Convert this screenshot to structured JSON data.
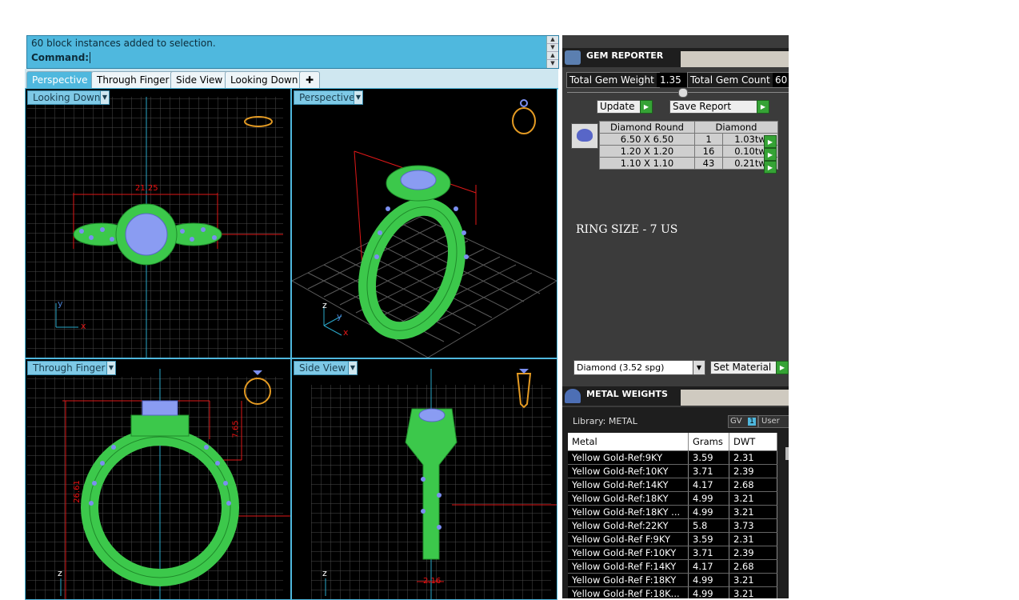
{
  "command": {
    "message": "60 block instances added to selection.",
    "prompt": "Command:"
  },
  "view_tabs": [
    {
      "label": "Perspective",
      "active": true
    },
    {
      "label": "Through Finger",
      "active": false
    },
    {
      "label": "Side View",
      "active": false
    },
    {
      "label": "Looking Down",
      "active": false
    }
  ],
  "add_tab_icon": "plus-icon",
  "viewports": {
    "looking_down": {
      "label": "Looking Down",
      "dimension": "21.25",
      "axis_y": "y",
      "axis_x": "x"
    },
    "perspective": {
      "label": "Perspective",
      "axis_z": "z",
      "axis_y": "y",
      "axis_x": "x"
    },
    "through_finger": {
      "label": "Through Finger",
      "dim_height": "26.61",
      "dim_top": "7.65",
      "axis_z": "z"
    },
    "side_view": {
      "label": "Side View",
      "dim_bottom": "2.16",
      "axis_z": "z"
    }
  },
  "gem_reporter": {
    "title": "GEM REPORTER",
    "total_weight_label": "Total Gem Weight",
    "total_weight_value": "1.35",
    "total_count_label": "Total Gem Count",
    "total_count_value": "60",
    "update_label": "Update",
    "save_report_label": "Save Report",
    "table_headers": [
      "Diamond Round",
      "Diamond"
    ],
    "rows": [
      {
        "size": "6.50 X 6.50",
        "count": "1",
        "weight": "1.03tw"
      },
      {
        "size": "1.20 X 1.20",
        "count": "16",
        "weight": "0.10tw"
      },
      {
        "size": "1.10 X 1.10",
        "count": "43",
        "weight": "0.21tw"
      }
    ],
    "ring_size": "RING SIZE - 7 US",
    "material_select": "Diamond    (3.52 spg)",
    "set_material_label": "Set Material"
  },
  "metal_weights": {
    "title": "METAL WEIGHTS",
    "library": "Library: METAL",
    "gv_label": "GV",
    "gv_value": "1",
    "user_label": "User",
    "headers": [
      "Metal",
      "Grams",
      "DWT"
    ],
    "rows": [
      [
        "Yellow Gold-Ref:9KY",
        "3.59",
        "2.31"
      ],
      [
        "Yellow Gold-Ref:10KY",
        "3.71",
        "2.39"
      ],
      [
        "Yellow Gold-Ref:14KY",
        "4.17",
        "2.68"
      ],
      [
        "Yellow Gold-Ref:18KY",
        "4.99",
        "3.21"
      ],
      [
        "Yellow Gold-Ref:18KY ...",
        "4.99",
        "3.21"
      ],
      [
        "Yellow Gold-Ref:22KY",
        "5.8",
        "3.73"
      ],
      [
        "Yellow Gold-Ref F:9KY",
        "3.59",
        "2.31"
      ],
      [
        "Yellow Gold-Ref F:10KY",
        "3.71",
        "2.39"
      ],
      [
        "Yellow Gold-Ref F:14KY",
        "4.17",
        "2.68"
      ],
      [
        "Yellow Gold-Ref F:18KY",
        "4.99",
        "3.21"
      ],
      [
        "Yellow Gold-Ref F:18K...",
        "4.99",
        "3.21"
      ]
    ]
  },
  "colors": {
    "accent": "#4fb8de",
    "model_green": "#39c94a",
    "gem_blue": "#7b8ff0",
    "dimension_red": "#e01818",
    "panel_bg": "#3b3b3b"
  }
}
